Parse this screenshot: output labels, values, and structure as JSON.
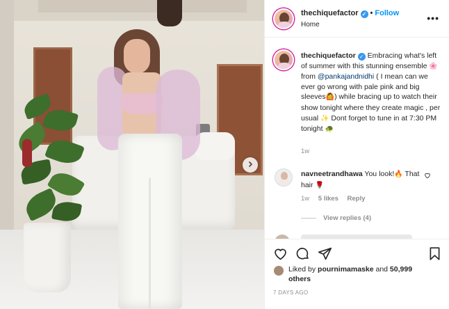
{
  "post": {
    "location": "Home",
    "follow_label": "Follow",
    "username": "thechiquefactor"
  },
  "caption": {
    "username": "thechiquefactor",
    "part1": " Embracing what's left of summer with this stunning ensemble ",
    "emoji1": "🌸",
    "part2": " from ",
    "mention": "@pankajandnidhi",
    "part3": " ( I mean can we ever go wrong with pale pink and big sleeves",
    "emoji2": "🙆",
    "part4": ") while bracing up to watch their show tonight where they create magic , per usual ",
    "emoji3": "✨",
    "part5": " Dont forget to tune in at 7:30 PM tonight ",
    "emoji4": "🐢",
    "time": "1w"
  },
  "comment": {
    "username": "navneetrandhawa",
    "text": " You look!",
    "emoji1": "🔥",
    "text2": " That hair ",
    "emoji2": "🌹",
    "time": "1w",
    "likes": "5 likes",
    "reply": "Reply",
    "view_replies": "View replies (4)"
  },
  "likes": {
    "prefix": "Liked by ",
    "user": "pournimamaske",
    "middle": " and ",
    "count": "50,999 others"
  },
  "date": "7 DAYS AGO",
  "icons": [
    "heart-icon",
    "comment-icon",
    "share-icon",
    "bookmark-icon",
    "more-icon",
    "chevron-right-icon",
    "verified-icon"
  ],
  "colors": {
    "accent": "#0095f6",
    "verified": "#3897f0",
    "muted": "#8e8e8e",
    "text": "#262626"
  }
}
